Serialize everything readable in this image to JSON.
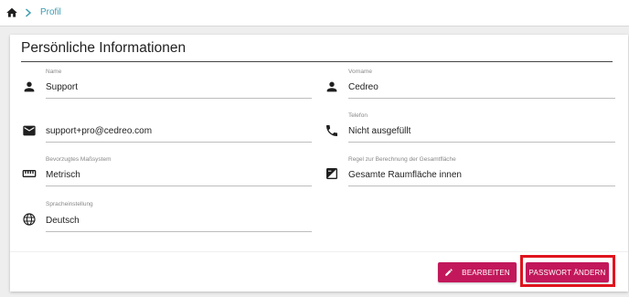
{
  "breadcrumb": {
    "home_icon": "home-icon",
    "separator_icon": "chevron-right-icon",
    "current": "Profil"
  },
  "section": {
    "title": "Persönliche Informationen"
  },
  "fields": {
    "name": {
      "label": "Name",
      "value": "Support",
      "icon": "person-icon"
    },
    "vorname": {
      "label": "Vorname",
      "value": "Cedreo",
      "icon": "person-icon"
    },
    "email": {
      "label": "",
      "value": "support+pro@cedreo.com",
      "icon": "envelope-icon"
    },
    "telefon": {
      "label": "Telefon",
      "value": "Nicht ausgefüllt",
      "icon": "phone-icon"
    },
    "masssystem": {
      "label": "Bevorzugtes Maßsystem",
      "value": "Metrisch",
      "icon": "ruler-icon"
    },
    "regel": {
      "label": "Regel zur Berechnung der Gesamtfläche",
      "value": "Gesamte Raumfläche innen",
      "icon": "area-calc-icon"
    },
    "sprache": {
      "label": "Spracheinstellung",
      "value": "Deutsch",
      "icon": "globe-icon"
    }
  },
  "actions": {
    "edit_label": "BEARBEITEN",
    "change_password_label": "PASSWORT ÄNDERN"
  },
  "colors": {
    "accent": "#c2185b",
    "link": "#3a9bb0",
    "highlight_frame": "#e0141e"
  }
}
